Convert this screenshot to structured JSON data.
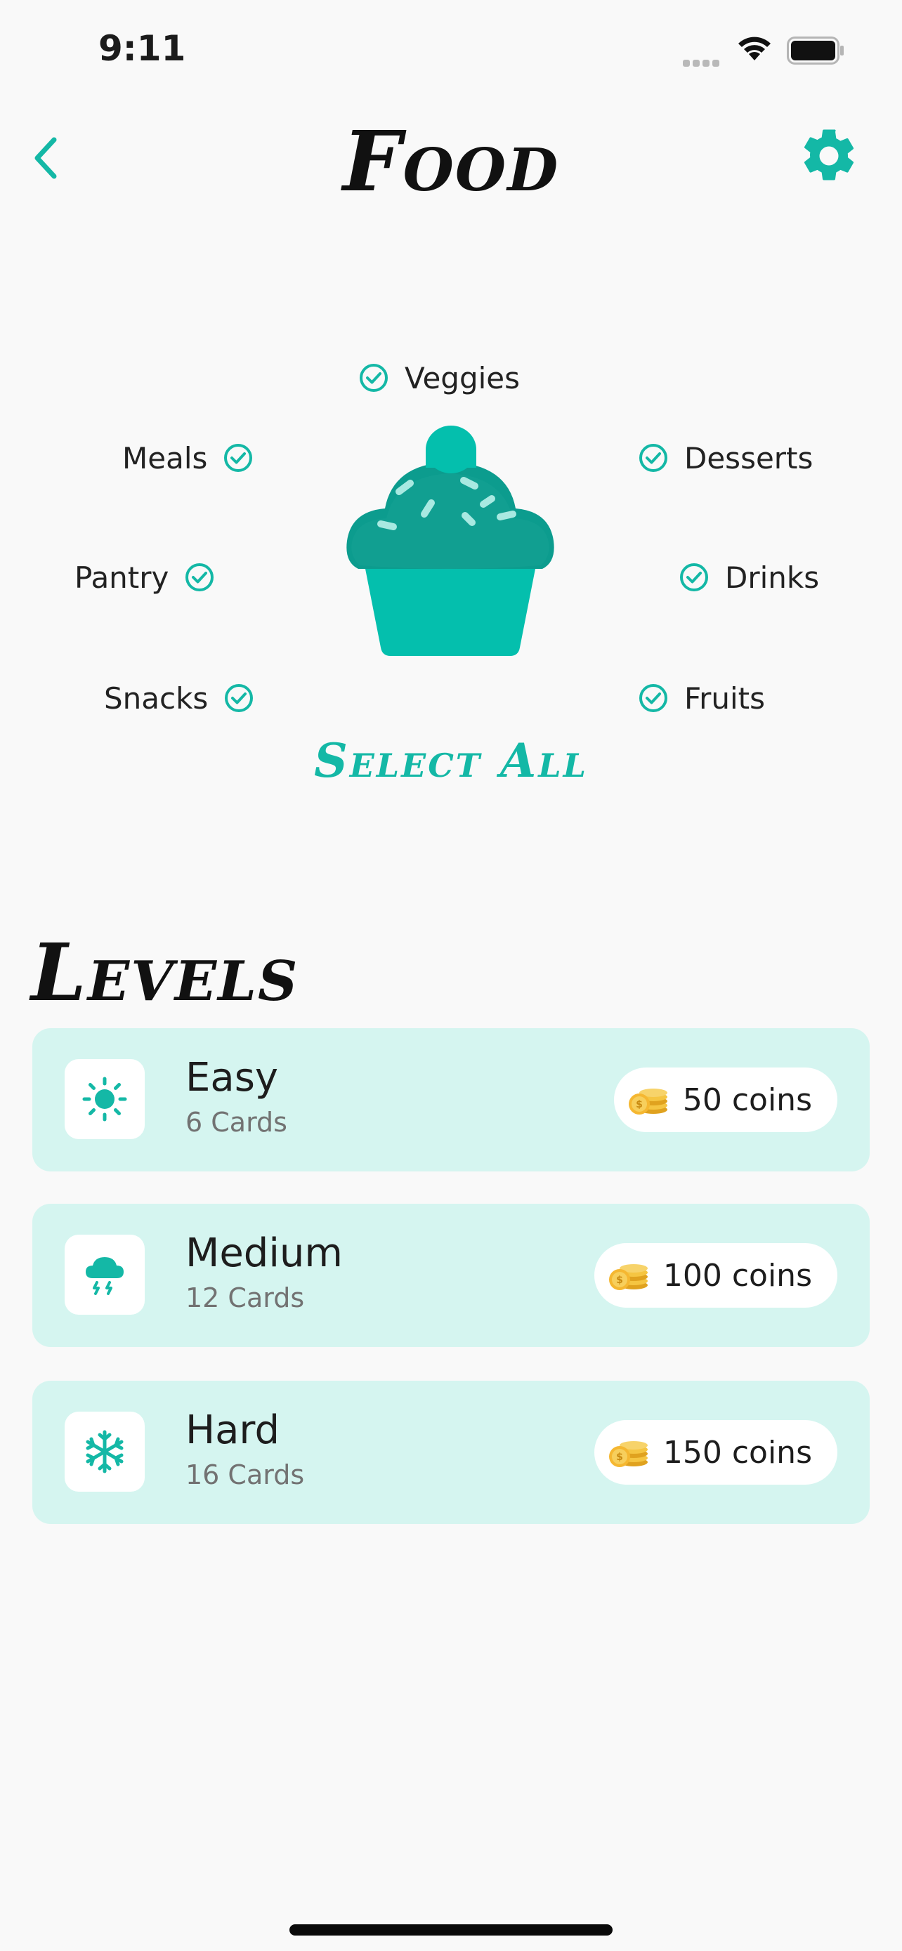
{
  "status_bar": {
    "time": "9:11"
  },
  "header": {
    "title": "Food"
  },
  "categories": [
    {
      "label": "Veggies",
      "checked": true
    },
    {
      "label": "Meals",
      "checked": true
    },
    {
      "label": "Desserts",
      "checked": true
    },
    {
      "label": "Pantry",
      "checked": true
    },
    {
      "label": "Drinks",
      "checked": true
    },
    {
      "label": "Snacks",
      "checked": true
    },
    {
      "label": "Fruits",
      "checked": true
    }
  ],
  "select_all_label": "Select All",
  "levels": {
    "heading": "Levels",
    "items": [
      {
        "name": "Easy",
        "cards": "6 Cards",
        "coins": "50 coins",
        "icon": "sun-icon"
      },
      {
        "name": "Medium",
        "cards": "12 Cards",
        "coins": "100 coins",
        "icon": "storm-cloud-icon"
      },
      {
        "name": "Hard",
        "cards": "16 Cards",
        "coins": "150 coins",
        "icon": "snowflake-icon"
      }
    ]
  },
  "colors": {
    "accent": "#14b8a6",
    "card_background": "#d5f5f0",
    "page_background": "#f9f9f9",
    "coin": "#f5c542"
  }
}
